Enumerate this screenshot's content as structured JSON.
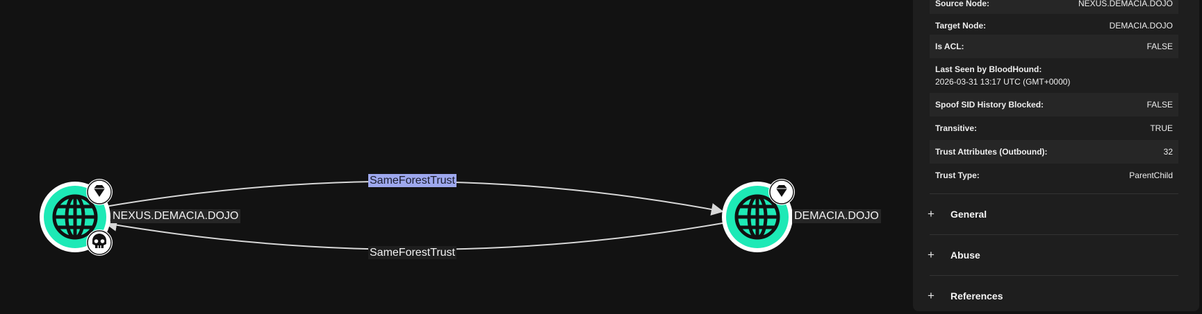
{
  "graph": {
    "nodes": [
      {
        "label": "NEXUS.DEMACIA.DOJO",
        "icon": "globe-icon",
        "badges": [
          "gem-icon",
          "skull-icon"
        ]
      },
      {
        "label": "DEMACIA.DOJO",
        "icon": "globe-icon",
        "badges": [
          "gem-icon"
        ]
      }
    ],
    "edges": [
      {
        "label": "SameForestTrust",
        "selected": true
      },
      {
        "label": "SameForestTrust",
        "selected": false
      }
    ],
    "colors": {
      "background": "#121212",
      "node_fill": "#1de9b6",
      "selected_edge_label": "#9ea8ee"
    }
  },
  "panel": {
    "properties": [
      {
        "key": "Source Node:",
        "value": "NEXUS.DEMACIA.DOJO"
      },
      {
        "key": "Target Node:",
        "value": "DEMACIA.DOJO"
      },
      {
        "key": "Is ACL:",
        "value": "FALSE"
      },
      {
        "key": "Last Seen by BloodHound:",
        "value": "2026-03-31 13:17 UTC (GMT+0000)"
      },
      {
        "key": "Spoof SID History Blocked:",
        "value": "FALSE"
      },
      {
        "key": "Transitive:",
        "value": "TRUE"
      },
      {
        "key": "Trust Attributes (Outbound):",
        "value": "32"
      },
      {
        "key": "Trust Type:",
        "value": "ParentChild"
      }
    ],
    "sections": [
      {
        "label": "General",
        "icon": "plus-icon"
      },
      {
        "label": "Abuse",
        "icon": "plus-icon"
      },
      {
        "label": "References",
        "icon": "plus-icon"
      }
    ]
  }
}
